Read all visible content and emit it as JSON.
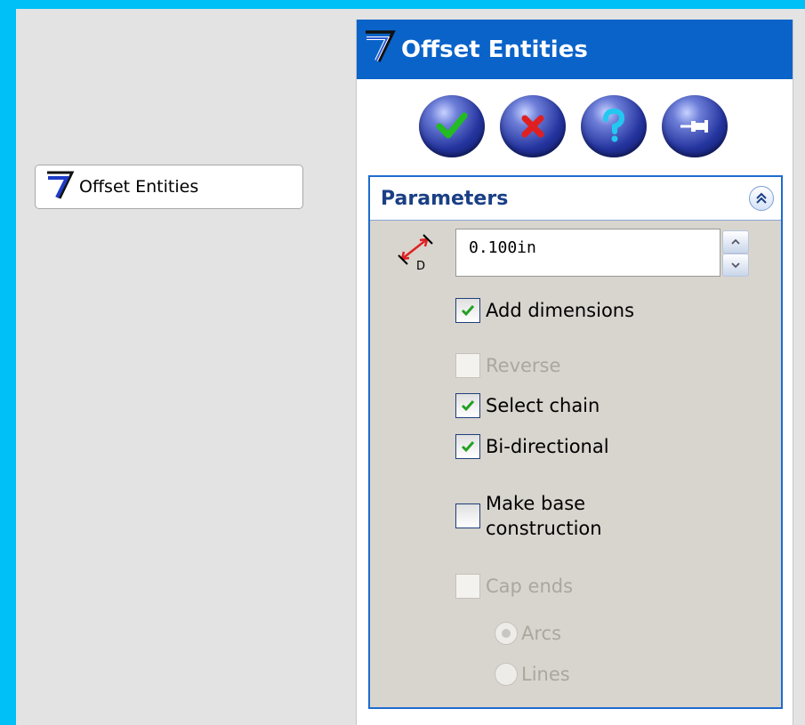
{
  "toolbar_button": {
    "label": "Offset Entities"
  },
  "property_manager": {
    "title": "Offset Entities",
    "actions": [
      {
        "name": "ok",
        "icon": "checkmark-icon",
        "color": "#22bb22"
      },
      {
        "name": "cancel",
        "icon": "x-icon",
        "color": "#e02020"
      },
      {
        "name": "help",
        "icon": "question-icon",
        "color": "#23c8f0"
      },
      {
        "name": "pin",
        "icon": "pushpin-icon",
        "color": "#ffffff"
      }
    ],
    "parameters": {
      "title": "Parameters",
      "distance": {
        "value": "0.100in",
        "icon_label": "D"
      },
      "options": {
        "add_dimensions": {
          "label": "Add dimensions",
          "checked": true,
          "enabled": true
        },
        "reverse": {
          "label": "Reverse",
          "checked": false,
          "enabled": false
        },
        "select_chain": {
          "label": "Select chain",
          "checked": true,
          "enabled": true
        },
        "bi_directional": {
          "label": "Bi-directional",
          "checked": true,
          "enabled": true
        },
        "make_base_construction": {
          "label_line1": "Make base",
          "label_line2": "construction",
          "checked": false,
          "enabled": true
        },
        "cap_ends": {
          "label": "Cap ends",
          "checked": false,
          "enabled": false
        }
      },
      "cap_type": {
        "arcs": {
          "label": "Arcs",
          "selected": true,
          "enabled": false
        },
        "lines": {
          "label": "Lines",
          "selected": false,
          "enabled": false
        }
      }
    }
  },
  "colors": {
    "background": "#00c0f8",
    "header": "#0a63c9",
    "group_border": "#1e6ccf",
    "check": "#22a022"
  }
}
